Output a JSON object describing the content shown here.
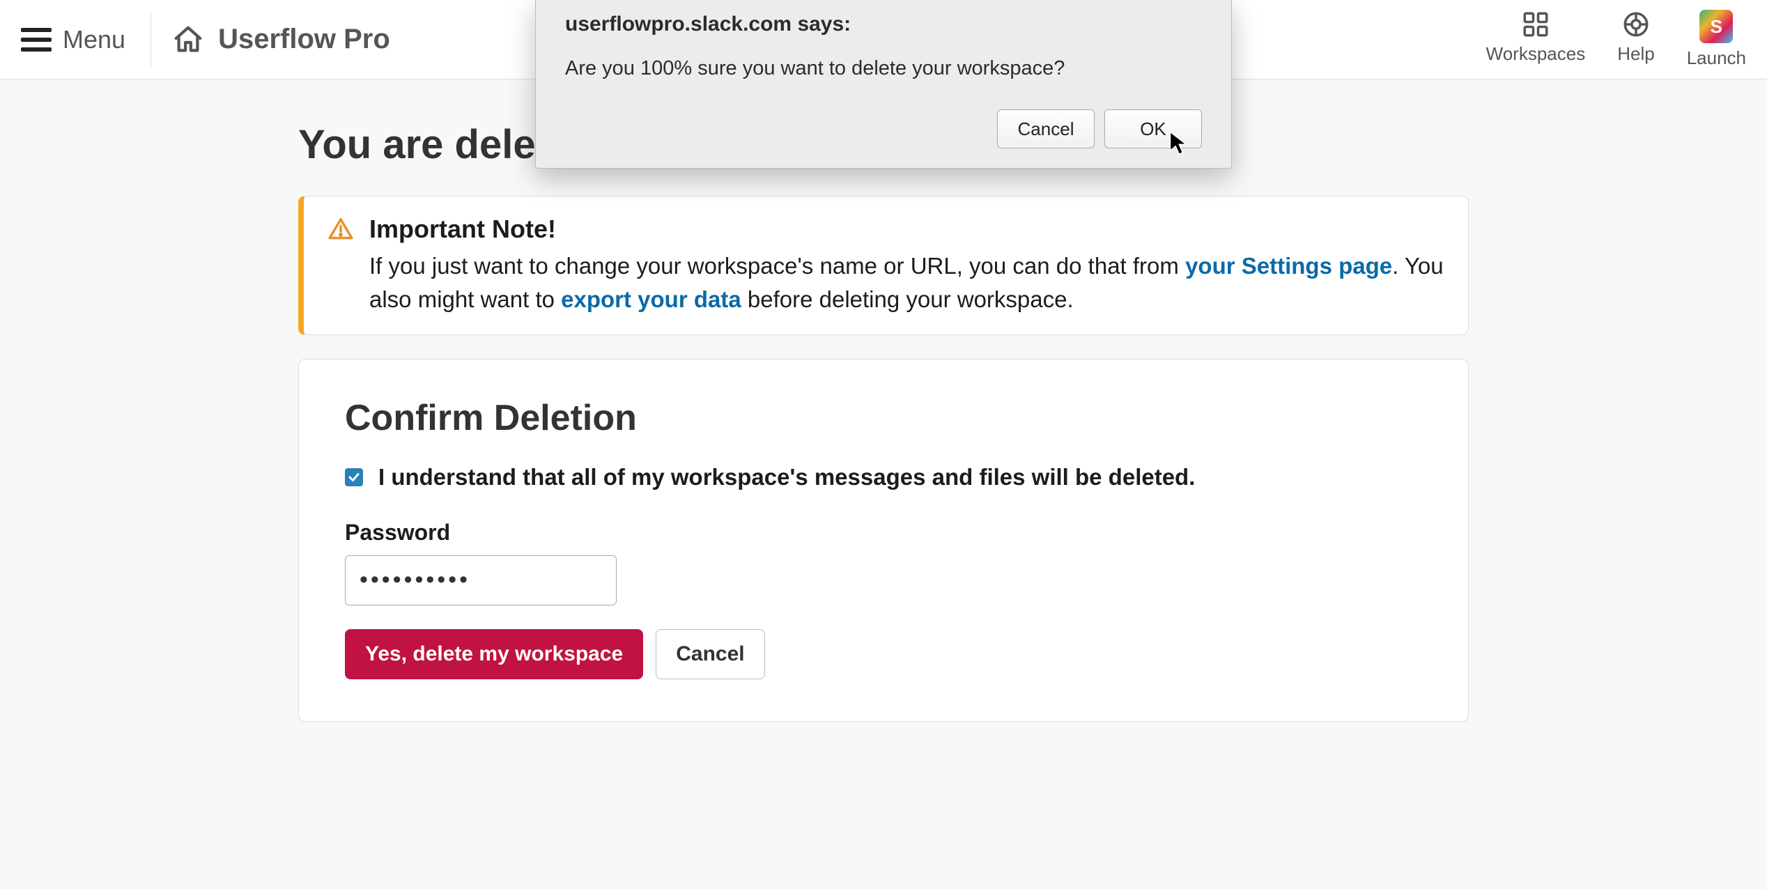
{
  "header": {
    "menu_label": "Menu",
    "brand_name": "Userflow Pro",
    "nav": {
      "workspaces": "Workspaces",
      "help": "Help",
      "launch": "Launch",
      "launch_initial": "S"
    }
  },
  "page": {
    "title": "You are deleting U"
  },
  "alert": {
    "title": "Important Note!",
    "text_1": "If you just want to change your workspace's name or URL, you can do that from ",
    "link_1": "your Settings page",
    "text_2": ". You also might want to ",
    "link_2": "export your data",
    "text_3": " before deleting your workspace."
  },
  "confirm": {
    "heading": "Confirm Deletion",
    "checkbox_label": "I understand that all of my workspace's messages and files will be deleted.",
    "checkbox_checked": true,
    "password_label": "Password",
    "password_value": "••••••••••",
    "delete_btn": "Yes, delete my workspace",
    "cancel_btn": "Cancel"
  },
  "dialog": {
    "origin": "userflowpro.slack.com says:",
    "message": "Are you 100% sure you want to delete your workspace?",
    "cancel": "Cancel",
    "ok": "OK"
  }
}
